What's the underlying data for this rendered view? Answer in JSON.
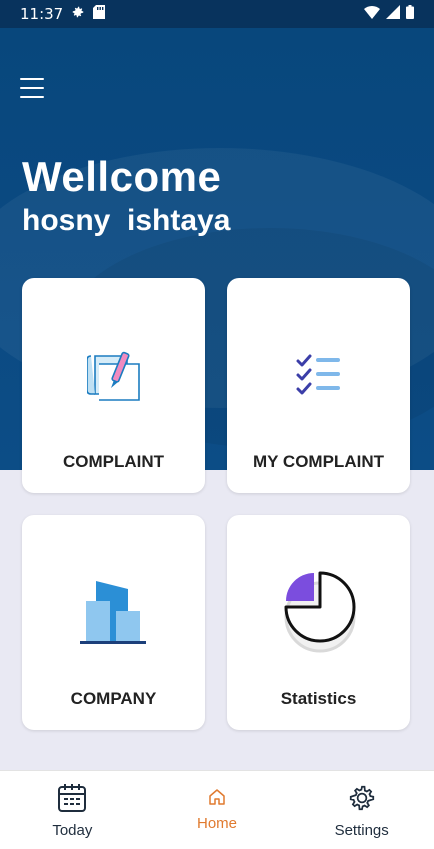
{
  "status_bar": {
    "time": "11:37",
    "icons": [
      "gear-icon",
      "sd-card-icon",
      "wifi-icon",
      "signal-icon",
      "battery-icon"
    ]
  },
  "header": {
    "menu_icon": "hamburger-menu-icon",
    "welcome": "Wellcome",
    "user_name": "hosny  ishtaya"
  },
  "cards": {
    "complaint": {
      "label": "COMPLAINT",
      "icon": "document-pen-icon"
    },
    "my_complaint": {
      "label": "MY COMPLAINT",
      "icon": "checklist-icon"
    },
    "company": {
      "label": "COMPANY",
      "icon": "buildings-icon"
    },
    "statistics": {
      "label": "Statistics",
      "icon": "pie-chart-icon"
    }
  },
  "bottom_nav": {
    "today": {
      "label": "Today",
      "icon": "calendar-icon"
    },
    "home": {
      "label": "Home",
      "icon": "home-icon",
      "active": true
    },
    "settings": {
      "label": "Settings",
      "icon": "gear-icon"
    }
  },
  "colors": {
    "header_blue": "#0b4a83",
    "status_bar": "#08335d",
    "background": "#e9e9f3",
    "active_nav": "#e07a2f",
    "card_text": "#222222"
  }
}
